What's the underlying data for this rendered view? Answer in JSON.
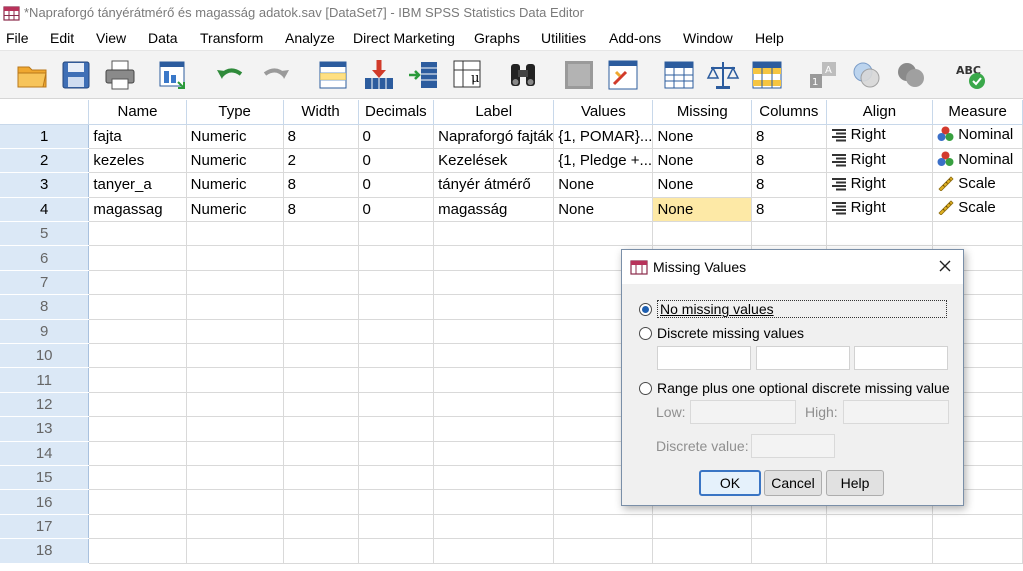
{
  "window": {
    "title": "*Napraforgó tányérátmérő és magasság adatok.sav [DataSet7] - IBM SPSS Statistics Data Editor"
  },
  "menubar": {
    "items": [
      "File",
      "Edit",
      "View",
      "Data",
      "Transform",
      "Analyze",
      "Direct Marketing",
      "Graphs",
      "Utilities",
      "Add-ons",
      "Window",
      "Help"
    ]
  },
  "toolbar": {
    "icons": [
      "open-folder-icon",
      "save-icon",
      "print-icon",
      "dialog-recall-icon",
      "undo-icon",
      "redo-icon",
      "goto-case-icon",
      "goto-variable-icon",
      "variables-icon",
      "descriptive-stats-icon",
      "find-icon",
      "insert-cases-icon",
      "insert-variable-icon",
      "split-file-icon",
      "weight-cases-icon",
      "select-cases-icon",
      "value-labels-icon",
      "use-sets-icon",
      "show-all-variables-icon",
      "spell-check-icon"
    ]
  },
  "grid": {
    "columns": [
      "Name",
      "Type",
      "Width",
      "Decimals",
      "Label",
      "Values",
      "Missing",
      "Columns",
      "Align",
      "Measure"
    ],
    "rows": [
      {
        "num": "1",
        "name": "fajta",
        "type": "Numeric",
        "width": "8",
        "decimals": "0",
        "label": "Napraforgó fajták",
        "values": "{1, POMAR}...",
        "missing": "None",
        "columns": "8",
        "align": "Right",
        "measure": "Nominal"
      },
      {
        "num": "2",
        "name": "kezeles",
        "type": "Numeric",
        "width": "2",
        "decimals": "0",
        "label": "Kezelések",
        "values": "{1, Pledge +...",
        "missing": "None",
        "columns": "8",
        "align": "Right",
        "measure": "Nominal"
      },
      {
        "num": "3",
        "name": "tanyer_a",
        "type": "Numeric",
        "width": "8",
        "decimals": "0",
        "label": "tányér átmérő",
        "values": "None",
        "missing": "None",
        "columns": "8",
        "align": "Right",
        "measure": "Scale"
      },
      {
        "num": "4",
        "name": "magassag",
        "type": "Numeric",
        "width": "8",
        "decimals": "0",
        "label": "magasság",
        "values": "None",
        "missing": "None",
        "columns": "8",
        "align": "Right",
        "measure": "Scale"
      }
    ],
    "empty_rows": [
      "5",
      "6",
      "7",
      "8",
      "9",
      "10",
      "11",
      "12",
      "13",
      "14",
      "15",
      "16",
      "17",
      "18"
    ],
    "selected_cell": {
      "row": "4",
      "column": "Missing"
    },
    "colors": {
      "row_header": "#dbe8f6",
      "selected": "#fde9a6"
    }
  },
  "dialog": {
    "title": "Missing Values",
    "option_none": "No missing values",
    "option_discrete": "Discrete missing values",
    "option_range": "Range plus one optional discrete missing value",
    "low_label": "Low:",
    "high_label": "High:",
    "discrete_value_label": "Discrete value:",
    "selected_option": "No missing values",
    "buttons": {
      "ok": "OK",
      "cancel": "Cancel",
      "help": "Help"
    }
  }
}
